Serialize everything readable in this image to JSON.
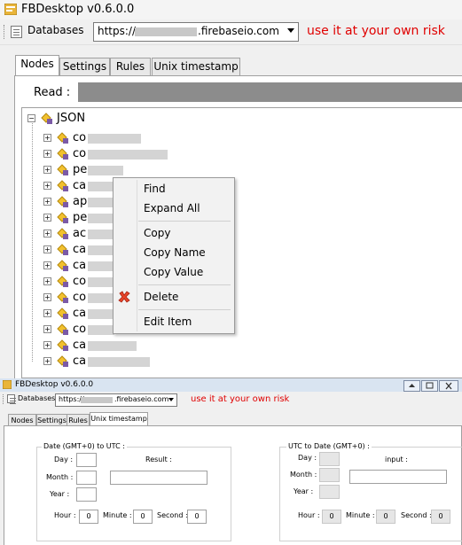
{
  "window1": {
    "title": "FBDesktop v0.6.0.0",
    "toolbar": {
      "databases_label": "Databases",
      "url_prefix": "https://",
      "url_suffix": ".firebaseio.com",
      "warning": "use it at your own risk"
    },
    "tabs": [
      {
        "label": "Nodes",
        "active": true
      },
      {
        "label": "Settings",
        "active": false
      },
      {
        "label": "Rules",
        "active": false
      },
      {
        "label": "Unix timestamp",
        "active": false
      }
    ],
    "read_label": "Read :",
    "tree": {
      "root": "JSON",
      "items": [
        "co",
        "co",
        "pe",
        "ca",
        "ap",
        "pe",
        "ac",
        "ca",
        "ca",
        "co",
        "co",
        "ca",
        "co",
        "ca",
        "ca"
      ]
    },
    "context_menu": {
      "items": [
        "Find",
        "Expand All",
        "Copy",
        "Copy Name",
        "Copy Value",
        "Delete",
        "Edit Item"
      ]
    }
  },
  "window2": {
    "title": "FBDesktop v0.6.0.0",
    "toolbar": {
      "databases_label": "Databases",
      "url_prefix": "https://c",
      "url_suffix": ".firebaseio.com",
      "warning": "use it at your own risk"
    },
    "tabs": [
      {
        "label": "Nodes",
        "active": false
      },
      {
        "label": "Settings",
        "active": false
      },
      {
        "label": "Rules",
        "active": false
      },
      {
        "label": "Unix timestamp",
        "active": true
      }
    ],
    "date_to_utc": {
      "group_title": "Date (GMT+0) to UTC :",
      "day_label": "Day :",
      "month_label": "Month :",
      "year_label": "Year :",
      "result_label": "Result :",
      "hour_label": "Hour :",
      "hour_value": "0",
      "minute_label": "Minute :",
      "minute_value": "0",
      "second_label": "Second :",
      "second_value": "0"
    },
    "utc_to_date": {
      "group_title": "UTC to Date (GMT+0) :",
      "day_label": "Day :",
      "month_label": "Month :",
      "year_label": "Year :",
      "input_label": "input :",
      "hour_label": "Hour :",
      "hour_value": "0",
      "minute_label": "Minute :",
      "minute_value": "0",
      "second_label": "Second :",
      "second_value": "0"
    }
  },
  "colors": {
    "warning": "#e00000",
    "redacted": "#8c8c8c"
  },
  "icons": [
    "app-icon",
    "database-icon",
    "json-node-icon",
    "delete-x-icon",
    "dropdown-arrow-icon",
    "minimize-icon",
    "restore-icon",
    "close-icon"
  ]
}
